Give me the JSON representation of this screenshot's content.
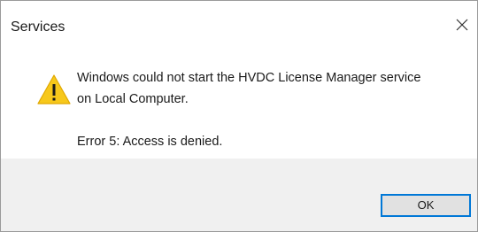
{
  "window": {
    "title": "Services",
    "close_icon": "close-icon"
  },
  "message": {
    "icon": "warning-icon",
    "icon_color": "#f7c81b",
    "line1": "Windows could not start the HVDC License Manager service",
    "line2": "on Local Computer.",
    "line3": "Error 5: Access is denied."
  },
  "buttons": {
    "ok_label": "OK"
  },
  "colors": {
    "footer_bg": "#f0f0f0",
    "button_border": "#0078d7"
  }
}
